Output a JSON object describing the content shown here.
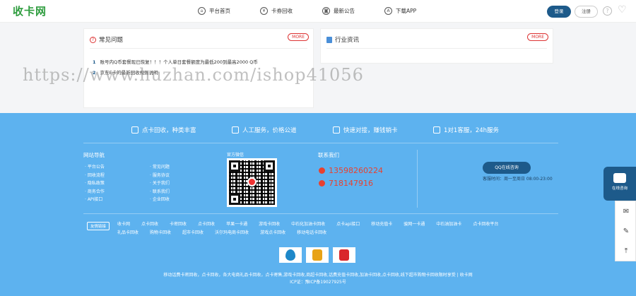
{
  "header": {
    "logo": "收卡网",
    "nav": [
      {
        "label": "平台首页",
        "icon": "home-icon",
        "glyph": "⌂"
      },
      {
        "label": "卡券回收",
        "icon": "yen-icon",
        "glyph": "¥"
      },
      {
        "label": "最新公告",
        "icon": "announcement-icon",
        "glyph": "◙"
      },
      {
        "label": "下载APP",
        "icon": "app-icon",
        "glyph": "A"
      }
    ],
    "login": "登录",
    "register": "注册"
  },
  "faq": {
    "title": "常见问题",
    "more": "MORE",
    "items": [
      {
        "num": "1",
        "text": "账号内Q币套餐现已恢复！！！个人单日套餐额度为最低200到最高2000 Q币"
      },
      {
        "num": "2",
        "text": "京东E卡的最新回收规则说明"
      }
    ]
  },
  "news": {
    "title": "行业资讯",
    "more": "MORE"
  },
  "watermark": "https://www.huzhan.com/ishop41056",
  "footer": {
    "features": [
      {
        "text": "点卡回收，种类丰富"
      },
      {
        "text": "人工服务，价格公道"
      },
      {
        "text": "快速对接，赚钱销卡"
      },
      {
        "text": "1对1客服，24h服务"
      }
    ],
    "nav_title": "网站导航",
    "nav_col1": [
      "· 平台公告",
      "· 回收流程",
      "· 隐私政策",
      "· 商务合作",
      "· API接口"
    ],
    "nav_col2": [
      "· 常见问题",
      "· 服务协议",
      "· 关于我们",
      "· 联系我们",
      "· 企业回收"
    ],
    "wechat_title": "官方微信",
    "contact_title": "联系我们",
    "phone": "13598260224",
    "qq": "718147916",
    "qq_button": "QQ在线咨询",
    "service_time": "客服时间：周一至周日 08:00-23:00",
    "friend_tag": "友情链接",
    "friend_links": [
      "收卡网",
      "点卡回收",
      "卡密回收",
      "点卡回收",
      "苹果一卡通",
      "游戏卡回收",
      "中石化加油卡回收",
      "点卡api接口",
      "移动充值卡",
      "骏网一卡通",
      "中石油加油卡",
      "点卡回收平台",
      "礼品卡回收",
      "购物卡回收",
      "超市卡回收",
      "沃尔玛电商卡回收",
      "游戏点卡回收",
      "移动电话卡回收"
    ],
    "bottom_line1": "移动话费卡密回收，点卡回收，各大电商礼品卡回收，点卡寄售,游戏卡回收,商超卡回收,话费充值卡回收,加油卡回收,点卡回收,线下超市购物卡回收限时享受 | 收卡网",
    "bottom_line2": "ICP证：豫ICP备19027925号"
  },
  "float": {
    "chat_label": "在线咨询"
  },
  "colors": {
    "brand_green": "#2f9d3f",
    "primary_blue": "#1d5a8a",
    "footer_bg": "#5db2ef",
    "accent_red": "#e8412f"
  }
}
